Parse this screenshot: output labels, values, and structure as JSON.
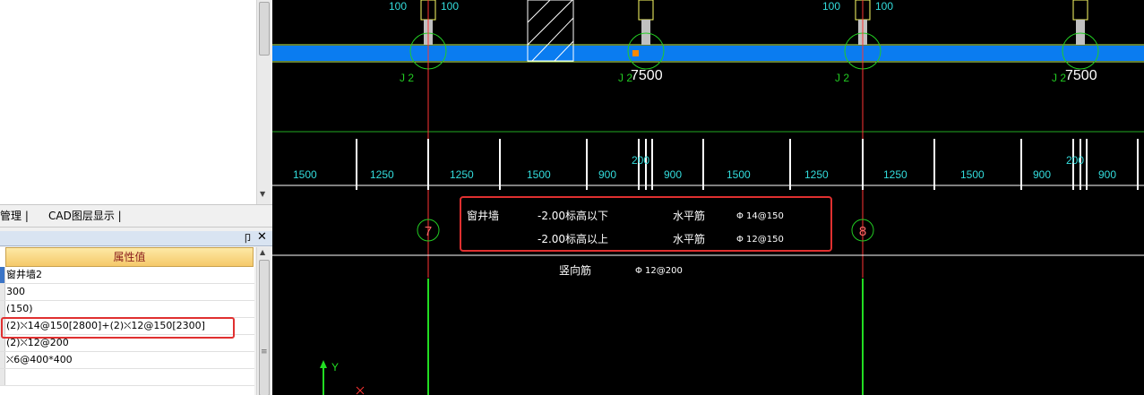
{
  "left_panel": {
    "tabs": [
      "管理",
      "CAD图层显示"
    ],
    "panel_buttons": {
      "pin": "卩",
      "close": "✕"
    },
    "property_header": "属性值",
    "property_values": [
      "窗井墙2",
      "300",
      "(150)",
      "(2)⛌14@150[2800]+(2)⛌12@150[2300]",
      "(2)⛌12@200",
      "⛌6@400*400"
    ]
  },
  "cad": {
    "background": "#000000",
    "wall_color": "#0a7cf0",
    "top_labels": [
      "100",
      "100",
      "100",
      "100"
    ],
    "span_labels": [
      "7500",
      "7500"
    ],
    "column_labels": [
      "J 2",
      "J 2",
      "J 2",
      "J 2"
    ],
    "dimensions": [
      "1500",
      "1250",
      "1250",
      "1500",
      "900",
      "200",
      "900",
      "1500",
      "1250",
      "1250",
      "1500",
      "900",
      "200",
      "900"
    ],
    "axis_bubbles": [
      "7",
      "8"
    ],
    "note": {
      "wall_name": "窗井墙",
      "row1_elevation": "-2.00标高以下",
      "row1_type": "水平筋",
      "row1_spec": "Φ 14@150",
      "row2_elevation": "-2.00标高以上",
      "row2_type": "水平筋",
      "row2_spec": "Φ 12@150",
      "vertical_type": "竖向筋",
      "vertical_spec": "Φ 12@200"
    },
    "ucs_label": "Y"
  }
}
